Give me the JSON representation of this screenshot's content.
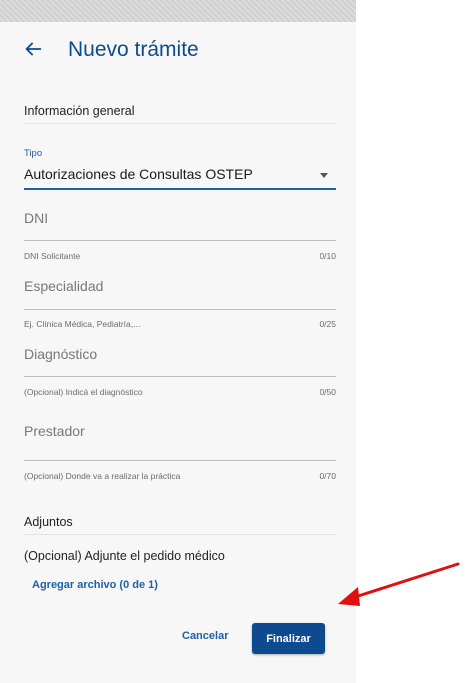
{
  "header": {
    "title": "Nuevo trámite",
    "back_icon": "arrow-left-icon"
  },
  "sections": {
    "general": "Información general",
    "adjuntos": "Adjuntos"
  },
  "tipo": {
    "label": "Tipo",
    "value": "Autorizaciones de Consultas OSTEP"
  },
  "fields": [
    {
      "placeholder": "DNI",
      "helper": "DNI Solicitante",
      "counter": "0/10"
    },
    {
      "placeholder": "Especialidad",
      "helper": "Ej. Clínica Médica, Pediatría,...",
      "counter": "0/25"
    },
    {
      "placeholder": "Diagnóstico",
      "helper": "(Opcional) Indicá el diagnóstico",
      "counter": "0/50"
    },
    {
      "placeholder": "Prestador",
      "helper": "(Opcional) Donde va a realizar la práctica",
      "counter": "0/70"
    }
  ],
  "adjuntos": {
    "text": "(Opcional) Adjunte el pedido médico",
    "add_label": "Agregar archivo (0 de 1)"
  },
  "actions": {
    "cancel": "Cancelar",
    "finalize": "Finalizar"
  },
  "colors": {
    "primary": "#0d4a8f",
    "accent": "#1f5fa8",
    "annotation_arrow": "#e01010"
  }
}
